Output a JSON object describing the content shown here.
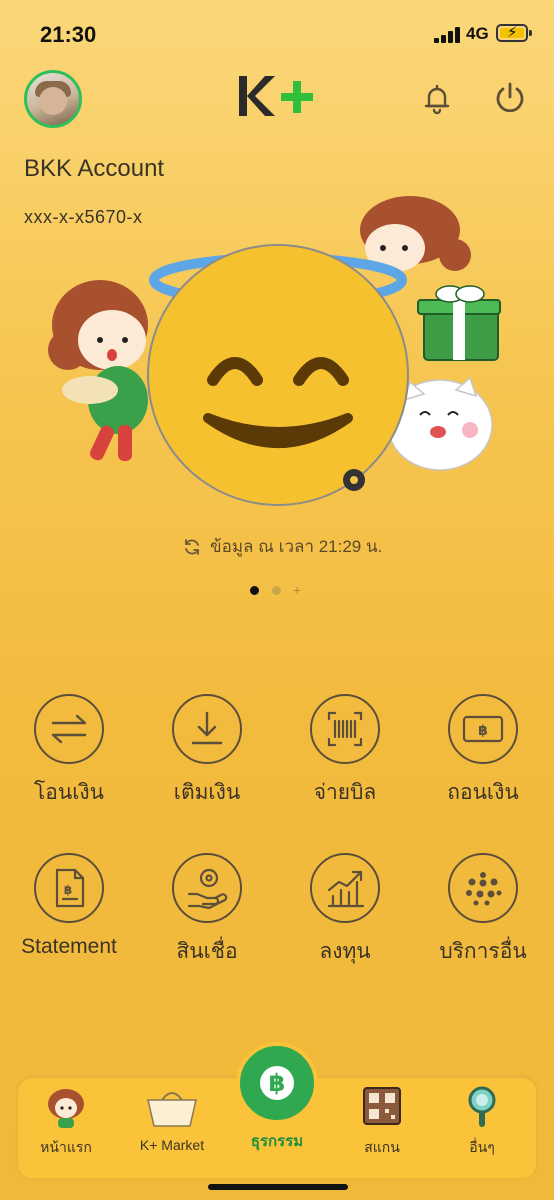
{
  "status_bar": {
    "time": "21:30",
    "network": "4G"
  },
  "header": {
    "logo_text": "K+",
    "profile_icon": "avatar",
    "notification_icon": "bell-icon",
    "logout_icon": "power-icon"
  },
  "account": {
    "name": "BKK Account",
    "number": "xxx-x-x5670-x"
  },
  "updated": {
    "text": "ข้อมูล ณ เวลา 21:29 น.",
    "icon": "refresh-icon"
  },
  "carousel": {
    "active_page": 1,
    "pages": 2,
    "has_add": true
  },
  "menu": [
    {
      "label": "โอนเงิน",
      "icon": "transfer-icon"
    },
    {
      "label": "เติมเงิน",
      "icon": "topup-icon"
    },
    {
      "label": "จ่ายบิล",
      "icon": "barcode-icon"
    },
    {
      "label": "ถอนเงิน",
      "icon": "withdraw-icon"
    },
    {
      "label": "Statement",
      "icon": "statement-icon"
    },
    {
      "label": "สินเชื่อ",
      "icon": "loan-icon"
    },
    {
      "label": "ลงทุน",
      "icon": "invest-icon"
    },
    {
      "label": "บริการอื่น",
      "icon": "more-services-icon"
    }
  ],
  "tabbar": {
    "items": [
      {
        "label": "หน้าแรก",
        "icon": "home-character-icon"
      },
      {
        "label": "K+ Market",
        "icon": "basket-icon"
      },
      {
        "label": "ธุรกรรม",
        "icon": "baht-icon",
        "active": true
      },
      {
        "label": "สแกน",
        "icon": "qr-scan-icon"
      },
      {
        "label": "อื่นๆ",
        "icon": "magnifier-icon"
      }
    ]
  },
  "colors": {
    "brand_green": "#2fa84f",
    "background": "#f3bb3e",
    "text": "#3b3325",
    "active_tab": "#1f8f3e"
  }
}
